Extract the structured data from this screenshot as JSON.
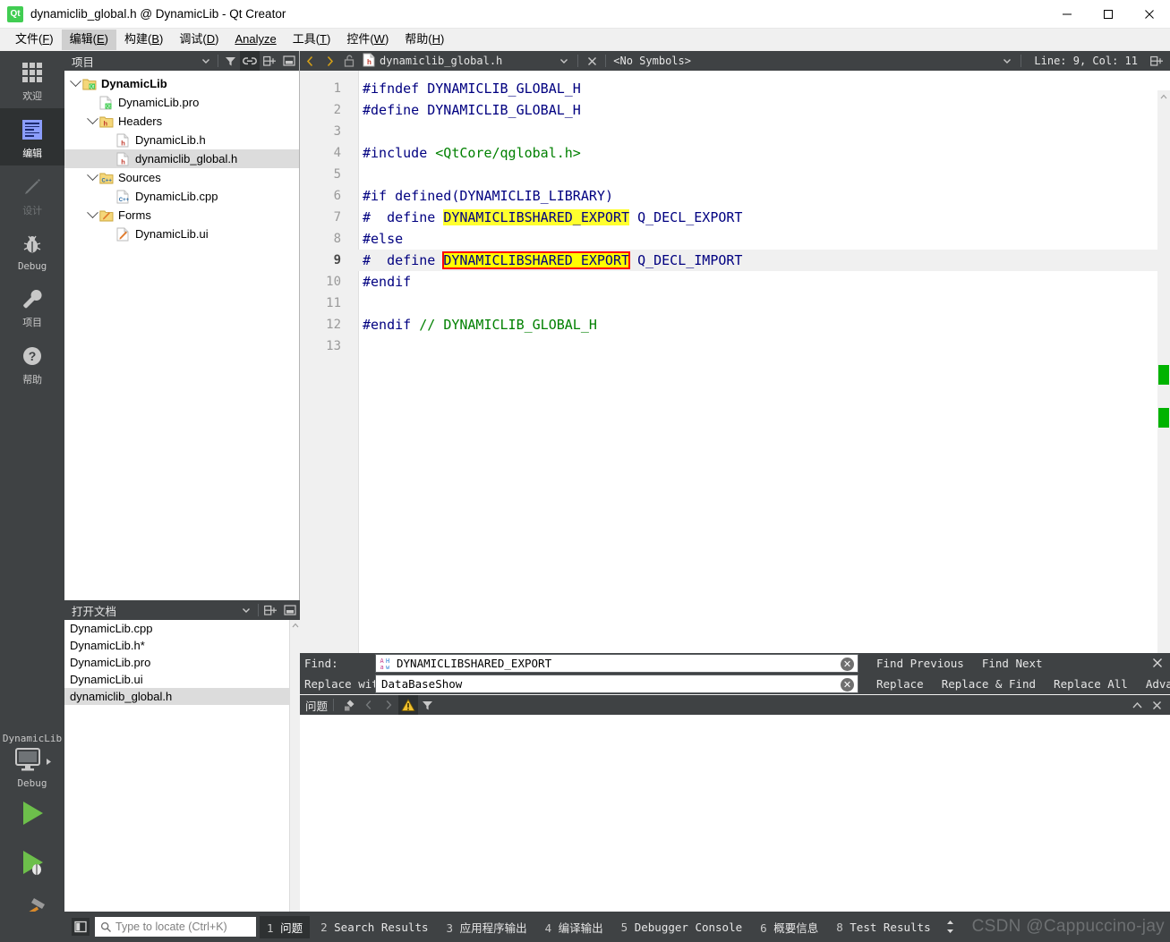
{
  "window": {
    "title": "dynamiclib_global.h @ DynamicLib - Qt Creator",
    "app_icon": "qt-logo-icon",
    "minimize": "minimize-icon",
    "maximize": "maximize-icon",
    "close": "close-icon"
  },
  "menubar": {
    "items": [
      {
        "label": "文件(F)",
        "active": false
      },
      {
        "label": "编辑(E)",
        "active": true
      },
      {
        "label": "构建(B)",
        "active": false
      },
      {
        "label": "调试(D)",
        "active": false
      },
      {
        "label": "Analyze",
        "active": false
      },
      {
        "label": "工具(T)",
        "active": false
      },
      {
        "label": "控件(W)",
        "active": false
      },
      {
        "label": "帮助(H)",
        "active": false
      }
    ]
  },
  "modebar": {
    "modes": [
      {
        "label": "欢迎",
        "icon": "grid-icon",
        "state": "normal"
      },
      {
        "label": "编辑",
        "icon": "document-lines-icon",
        "state": "selected"
      },
      {
        "label": "设计",
        "icon": "pencil-icon",
        "state": "disabled"
      },
      {
        "label": "Debug",
        "icon": "bug-icon",
        "state": "normal"
      },
      {
        "label": "项目",
        "icon": "wrench-icon",
        "state": "normal"
      },
      {
        "label": "帮助",
        "icon": "question-mark-icon",
        "state": "normal"
      }
    ],
    "kit": {
      "project": "DynamicLib",
      "build_config": "Debug",
      "selector_icon": "desktop-target-icon",
      "run_icon": "run-play-icon",
      "debug_icon": "run-debug-icon",
      "build_icon": "build-hammer-icon"
    }
  },
  "project_panel": {
    "title": "项目",
    "toolbar": [
      {
        "name": "view-filter-dropdown",
        "icon": "chevron-down-icon"
      },
      {
        "name": "filter-tree-button",
        "icon": "funnel-icon"
      },
      {
        "name": "sync-with-editor-button",
        "icon": "link-icon",
        "on": true
      },
      {
        "name": "split-button",
        "icon": "split-icon"
      },
      {
        "name": "close-panel-button",
        "icon": "close-split-icon"
      }
    ],
    "tree": [
      {
        "label": "DynamicLib",
        "depth": 0,
        "expanded": true,
        "icon": "qt-project-icon",
        "bold": true,
        "selected": false
      },
      {
        "label": "DynamicLib.pro",
        "depth": 1,
        "expanded": null,
        "icon": "pro-file-icon",
        "bold": false,
        "selected": false
      },
      {
        "label": "Headers",
        "depth": 1,
        "expanded": true,
        "icon": "headers-folder-icon",
        "bold": false,
        "selected": false
      },
      {
        "label": "DynamicLib.h",
        "depth": 2,
        "expanded": null,
        "icon": "h-file-icon",
        "bold": false,
        "selected": false
      },
      {
        "label": "dynamiclib_global.h",
        "depth": 2,
        "expanded": null,
        "icon": "h-file-icon",
        "bold": false,
        "selected": true
      },
      {
        "label": "Sources",
        "depth": 1,
        "expanded": true,
        "icon": "sources-folder-icon",
        "bold": false,
        "selected": false
      },
      {
        "label": "DynamicLib.cpp",
        "depth": 2,
        "expanded": null,
        "icon": "cpp-file-icon",
        "bold": false,
        "selected": false
      },
      {
        "label": "Forms",
        "depth": 1,
        "expanded": true,
        "icon": "forms-folder-icon",
        "bold": false,
        "selected": false
      },
      {
        "label": "DynamicLib.ui",
        "depth": 2,
        "expanded": null,
        "icon": "ui-file-icon",
        "bold": false,
        "selected": false
      }
    ]
  },
  "open_documents": {
    "title": "打开文档",
    "toolbar": [
      {
        "name": "opendocs-dropdown",
        "icon": "chevron-down-icon"
      },
      {
        "name": "opendocs-split-button",
        "icon": "split-icon"
      },
      {
        "name": "opendocs-close-button",
        "icon": "close-split-icon"
      }
    ],
    "items": [
      {
        "label": "DynamicLib.cpp",
        "selected": false
      },
      {
        "label": "DynamicLib.h*",
        "selected": false
      },
      {
        "label": "DynamicLib.pro",
        "selected": false
      },
      {
        "label": "DynamicLib.ui",
        "selected": false
      },
      {
        "label": "dynamiclib_global.h",
        "selected": true
      }
    ]
  },
  "editor": {
    "toolbar": {
      "back_icon": "chevron-left-icon",
      "forward_icon": "chevron-right-icon",
      "lock_icon": "unlocked-padlock-icon",
      "file_icon": "h-file-icon",
      "filename": "dynamiclib_global.h",
      "file_dropdown_icon": "chevron-down-icon",
      "close_icon": "close-icon",
      "symbols": "<No Symbols>",
      "symbols_dropdown_icon": "chevron-down-icon",
      "cursor_position": "Line: 9, Col: 11",
      "split_icon": "split-icon"
    },
    "current_line": 9,
    "lines": [
      {
        "num": 1,
        "tokens": [
          {
            "t": "#ifndef ",
            "c": "kw"
          },
          {
            "t": "DYNAMICLIB_GLOBAL_H",
            "c": "macro"
          }
        ]
      },
      {
        "num": 2,
        "tokens": [
          {
            "t": "#define ",
            "c": "kw"
          },
          {
            "t": "DYNAMICLIB_GLOBAL_H",
            "c": "macro"
          }
        ]
      },
      {
        "num": 3,
        "tokens": []
      },
      {
        "num": 4,
        "tokens": [
          {
            "t": "#include ",
            "c": "kw"
          },
          {
            "t": "<QtCore/qglobal.h>",
            "c": "str"
          }
        ]
      },
      {
        "num": 5,
        "tokens": []
      },
      {
        "num": 6,
        "tokens": [
          {
            "t": "#if defined(",
            "c": "kw"
          },
          {
            "t": "DYNAMICLIB_LIBRARY",
            "c": "macro"
          },
          {
            "t": ")",
            "c": "kw"
          }
        ]
      },
      {
        "num": 7,
        "tokens": [
          {
            "t": "#  define ",
            "c": "kw"
          },
          {
            "t": "DYNAMICLIBSHARED_EXPORT",
            "c": "macro",
            "hl": "yellow"
          },
          {
            "t": " ",
            "c": "plain"
          },
          {
            "t": "Q_DECL_EXPORT",
            "c": "macro"
          }
        ]
      },
      {
        "num": 8,
        "tokens": [
          {
            "t": "#else",
            "c": "kw"
          }
        ]
      },
      {
        "num": 9,
        "tokens": [
          {
            "t": "#  define ",
            "c": "kw"
          },
          {
            "t": "DYNAMICLIBSHARED_EXPORT",
            "c": "macro",
            "hl": "selected"
          },
          {
            "t": " ",
            "c": "plain"
          },
          {
            "t": "Q_DECL_IMPORT",
            "c": "macro"
          }
        ]
      },
      {
        "num": 10,
        "tokens": [
          {
            "t": "#endif",
            "c": "kw"
          }
        ]
      },
      {
        "num": 11,
        "tokens": []
      },
      {
        "num": 12,
        "tokens": [
          {
            "t": "#endif ",
            "c": "kw"
          },
          {
            "t": "// ",
            "c": "cmt"
          },
          {
            "t": "DYNAMICLIB_GLOBAL_H",
            "c": "cmt"
          }
        ]
      },
      {
        "num": 13,
        "tokens": []
      }
    ],
    "scroll_markers": [
      {
        "line": 7,
        "color": "#00b300"
      },
      {
        "line": 9,
        "color": "#00b300"
      }
    ]
  },
  "find_bar": {
    "find_label": "Find:",
    "find_value": "DYNAMICLIBSHARED_EXPORT",
    "find_case_icon": "case-sensitive-icon",
    "replace_label": "Replace with:",
    "replace_value": "DataBaseShow",
    "clear_icon": "clear-circle-icon",
    "close_icon": "close-icon",
    "actions_row1": [
      {
        "label": "Find Previous",
        "name": "find-previous-button"
      },
      {
        "label": "Find Next",
        "name": "find-next-button"
      }
    ],
    "actions_row2": [
      {
        "label": "Replace",
        "name": "replace-button"
      },
      {
        "label": "Replace & Find",
        "name": "replace-and-find-button"
      },
      {
        "label": "Replace All",
        "name": "replace-all-button"
      },
      {
        "label": "Advanced...",
        "name": "advanced-button"
      }
    ]
  },
  "output_pane": {
    "title": "问题",
    "toolbar": [
      {
        "name": "clear-output-button",
        "icon": "clear-pane-icon",
        "on": false
      },
      {
        "name": "previous-item-button",
        "icon": "chevron-left-icon",
        "on": false
      },
      {
        "name": "next-item-button",
        "icon": "chevron-right-icon",
        "on": false
      },
      {
        "name": "show-warnings-button",
        "icon": "warning-triangle-icon",
        "on": true
      },
      {
        "name": "filter-button",
        "icon": "funnel-icon",
        "on": false
      }
    ],
    "maximize_icon": "chevron-up-icon",
    "close_icon": "close-icon"
  },
  "statusbar": {
    "sidebar_toggle_icon": "sidebar-toggle-icon",
    "locator_icon": "search-icon",
    "locator_placeholder": "Type to locate (Ctrl+K)",
    "tabs": [
      {
        "num": "1",
        "label": "问题",
        "active": true
      },
      {
        "num": "2",
        "label": "Search Results",
        "active": false
      },
      {
        "num": "3",
        "label": "应用程序输出",
        "active": false
      },
      {
        "num": "4",
        "label": "编译输出",
        "active": false
      },
      {
        "num": "5",
        "label": "Debugger Console",
        "active": false
      },
      {
        "num": "6",
        "label": "概要信息",
        "active": false
      },
      {
        "num": "8",
        "label": "Test Results",
        "active": false
      }
    ],
    "updown_icon": "up-down-arrows-icon",
    "watermark": "CSDN @Cappuccino-jay"
  },
  "colors": {
    "chrome_dark": "#3f4244",
    "chrome_dark_selected": "#2e3132",
    "highlight_yellow": "#ffff2e",
    "selection_outline": "#ff0000",
    "marker_green": "#00b300",
    "tree_selected": "#dcdcdc",
    "qt_green": "#41cd52",
    "macro_blue": "#000080",
    "string_green": "#008000"
  }
}
